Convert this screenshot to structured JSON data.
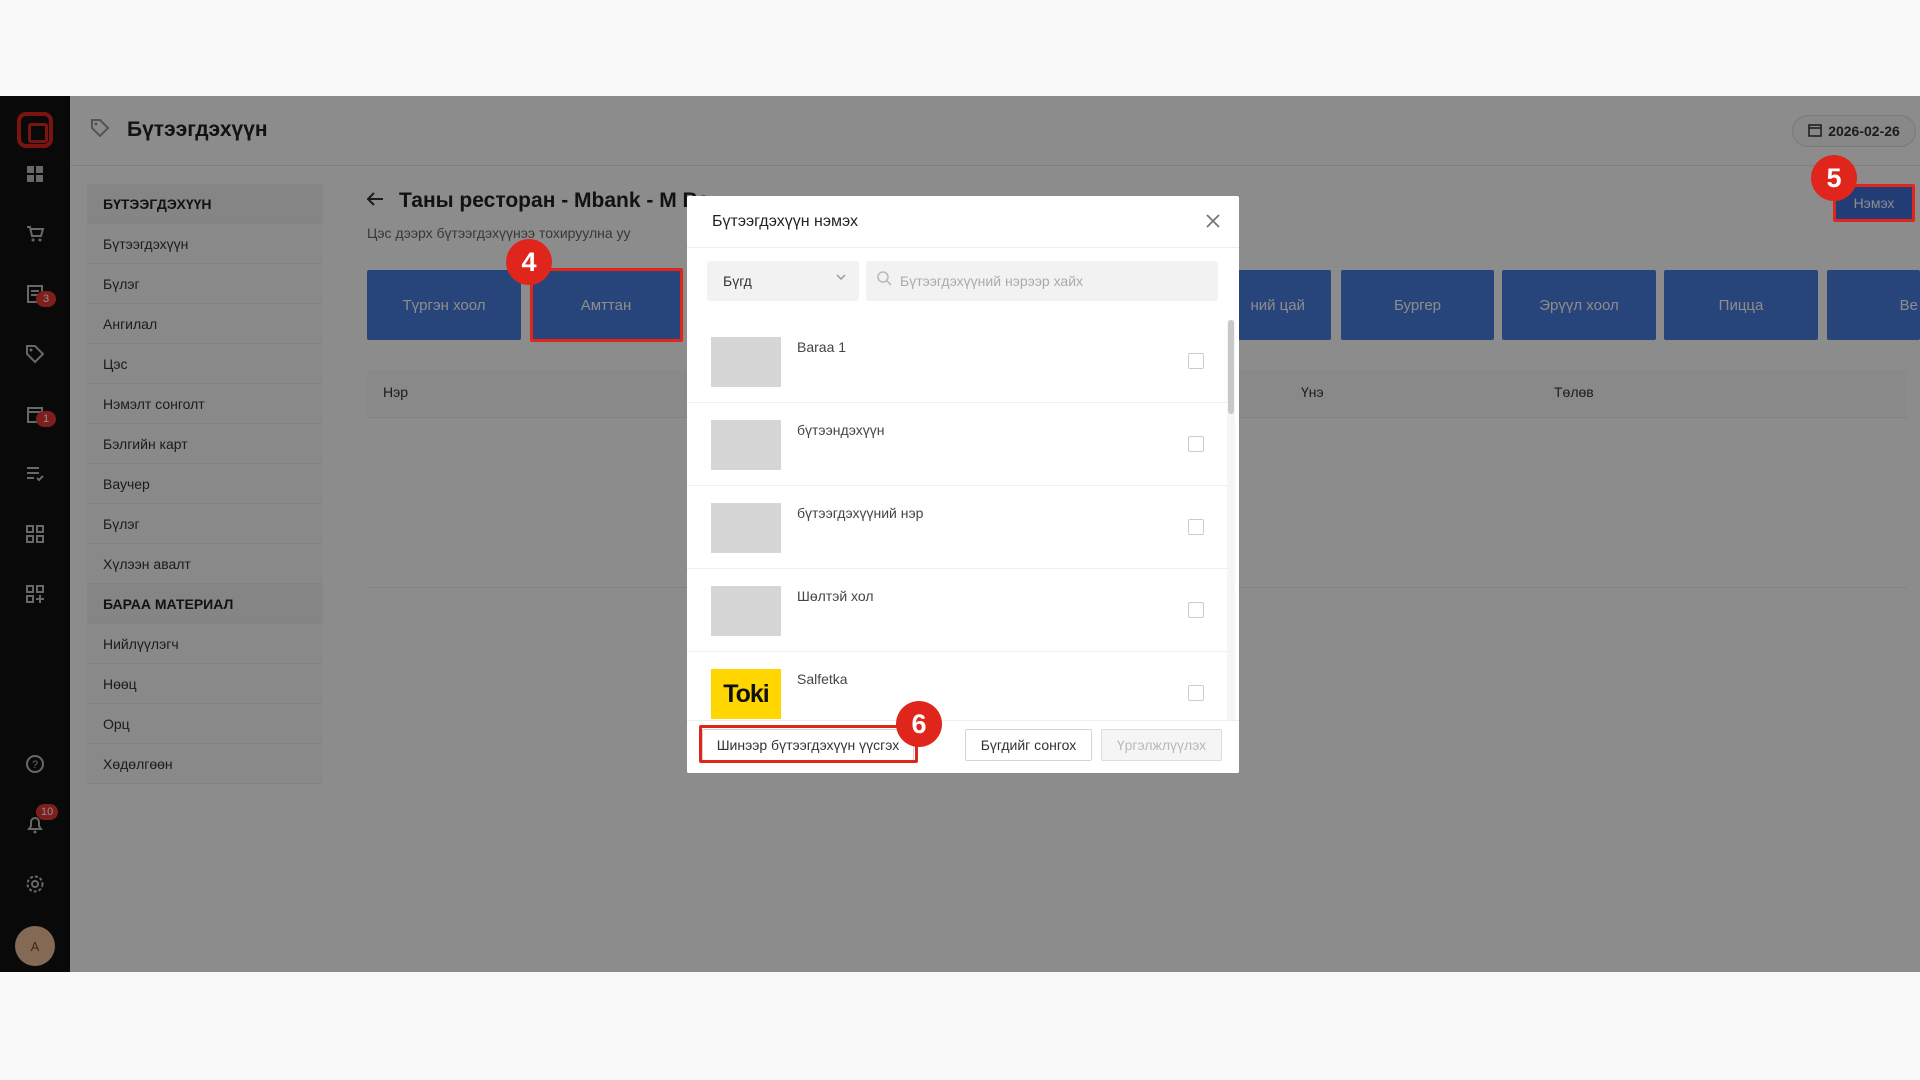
{
  "header": {
    "title": "Бүтээгдэхүүн",
    "date": "2026-02-26"
  },
  "rail": {
    "icons": [
      "dashboard-icon",
      "cart-icon",
      "orders-icon",
      "tag-icon",
      "calendar-icon",
      "list-check-icon",
      "grid-icon",
      "grid-add-icon",
      "help-icon",
      "bell-icon",
      "settings-icon"
    ],
    "badges": {
      "orders": "3",
      "calendar": "1",
      "bell": "10"
    },
    "avatar_initial": "A"
  },
  "submenu": {
    "section1": "БҮТЭЭГДЭХҮҮН",
    "items1": [
      "Бүтээгдэхүүн",
      "Бүлэг",
      "Ангилал",
      "Цэс",
      "Нэмэлт сонголт",
      "Бэлгийн карт",
      "Ваучер",
      "Бүлэг",
      "Хүлээн авалт"
    ],
    "section2": "БАРАА МАТЕРИАЛ",
    "items2": [
      "Нийлүүлэгч",
      "Нөөц",
      "Орц",
      "Хөдөлгөөн"
    ]
  },
  "content": {
    "title": "Таны ресторан - Mbank - M Ba",
    "subtitle": "Цэс дээрх бүтээгдэхүүнээ тохируулна уу",
    "add_button": "Нэмэх",
    "categories": [
      "Түргэн хоол",
      "Амттан",
      "ний цай",
      "Бургер",
      "Эрүүл хоол",
      "Пицца",
      "Be"
    ],
    "columns": [
      "Нэр",
      "Үнэ",
      "Төлөв"
    ]
  },
  "modal": {
    "title": "Бүтээгдэхүүн нэмэх",
    "filter_value": "Бүгд",
    "search_placeholder": "Бүтээгдэхүүний нэрээр хайх",
    "items": [
      {
        "name": "Baraa 1",
        "thumb": ""
      },
      {
        "name": "бүтээндэхүүн",
        "thumb": ""
      },
      {
        "name": "бүтээгдэхүүний нэр",
        "thumb": ""
      },
      {
        "name": "Шөлтэй хол",
        "thumb": ""
      },
      {
        "name": "Salfetka",
        "thumb": "Toki"
      }
    ],
    "create_new_button": "Шинээр бүтээгдэхүүн үүсгэх",
    "select_all_button": "Бүгдийг сонгох",
    "continue_button": "Үргэлжлүүлэх"
  },
  "markers": {
    "m4": "4",
    "m5": "5",
    "m6": "6"
  },
  "colors": {
    "accent": "#4a7fe0",
    "highlight": "#e0261c",
    "rail": "#121212"
  }
}
